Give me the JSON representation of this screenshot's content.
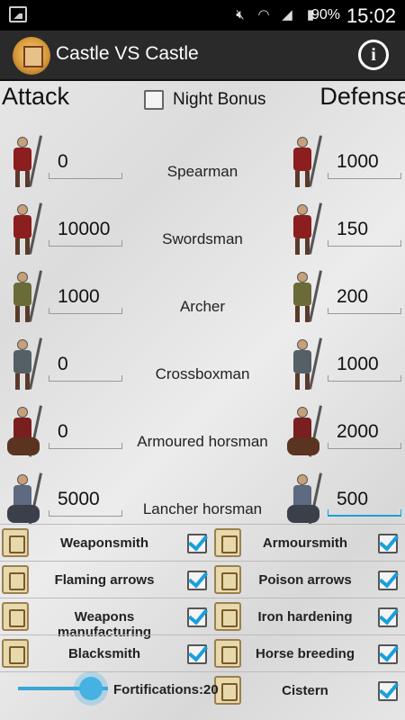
{
  "status_bar": {
    "battery_percent": "90%",
    "time": "15:02",
    "icons": [
      "gallery-icon",
      "mute-icon",
      "wifi-icon",
      "signal-icon",
      "battery-icon"
    ]
  },
  "app_bar": {
    "title": "Castle VS Castle",
    "info_label": "i"
  },
  "headers": {
    "attack": "Attack",
    "defense": "Defense",
    "night_bonus_label": "Night Bonus",
    "night_bonus_checked": false
  },
  "units": [
    {
      "name": "Spearman",
      "attack": "0",
      "defense": "1000",
      "icon": "spearman-icon"
    },
    {
      "name": "Swordsman",
      "attack": "10000",
      "defense": "150",
      "icon": "swordsman-icon"
    },
    {
      "name": "Archer",
      "attack": "1000",
      "defense": "200",
      "icon": "archer-icon"
    },
    {
      "name": "Crossboxman",
      "attack": "0",
      "defense": "1000",
      "icon": "crossbowman-icon"
    },
    {
      "name": "Armoured horsman",
      "attack": "0",
      "defense": "2000",
      "icon": "armoured-horseman-icon"
    },
    {
      "name": "Lancher horsman",
      "attack": "5000",
      "defense": "500",
      "icon": "lancer-horseman-icon"
    }
  ],
  "upgrades_left": [
    {
      "label": "Weaponsmith",
      "checked": true
    },
    {
      "label": "Flaming arrows",
      "checked": true
    },
    {
      "label": "Weapons manufacturing",
      "checked": true
    },
    {
      "label": "Blacksmith",
      "checked": true
    }
  ],
  "upgrades_right": [
    {
      "label": "Armoursmith",
      "checked": true
    },
    {
      "label": "Poison arrows",
      "checked": true
    },
    {
      "label": "Iron hardening",
      "checked": true
    },
    {
      "label": "Horse breeding",
      "checked": true
    },
    {
      "label": "Cistern",
      "checked": true
    }
  ],
  "fortifications": {
    "label": "Fortifications:20",
    "value": 20
  },
  "colors": {
    "accent": "#1a9fdc",
    "action_bar": "#2a2a2a"
  }
}
